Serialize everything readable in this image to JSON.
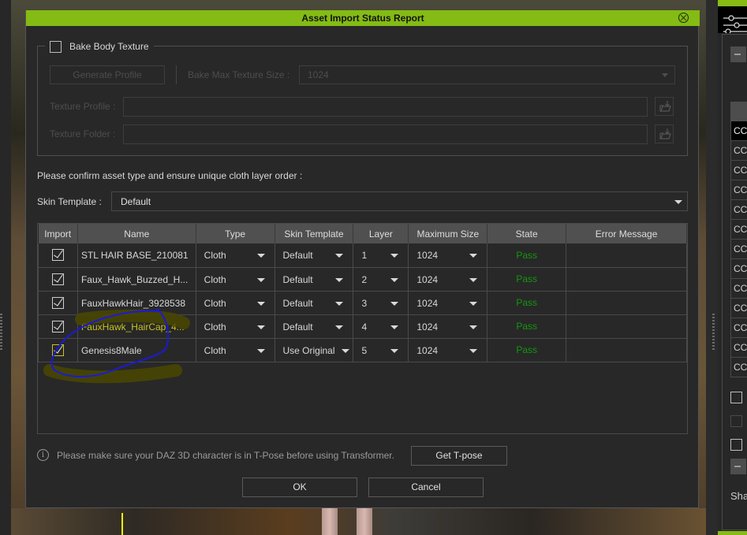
{
  "dialog": {
    "title": "Asset Import Status Report",
    "close_icon": "close-circle-icon",
    "bake_body_texture": {
      "label": "Bake Body Texture",
      "checked": false
    },
    "generate_profile_label": "Generate Profile",
    "bake_max_texture_size_label": "Bake Max Texture Size :",
    "bake_max_texture_size_value": "1024",
    "texture_profile_label": "Texture Profile :",
    "texture_profile_value": "",
    "texture_folder_label": "Texture Folder :",
    "texture_folder_value": "",
    "browse_icon": "folder-import-icon",
    "instruction": "Please confirm asset type and ensure unique cloth layer order :",
    "skin_template_label": "Skin Template :",
    "skin_template_value": "Default",
    "table": {
      "columns": [
        "Import",
        "Name",
        "Type",
        "Skin Template",
        "Layer",
        "Maximum Size",
        "State",
        "Error Message"
      ],
      "rows": [
        {
          "import": true,
          "name": "STL HAIR BASE_210081",
          "type": "Cloth",
          "skin_template": "Default",
          "layer": "1",
          "max_size": "1024",
          "state": "Pass",
          "error": ""
        },
        {
          "import": true,
          "name": "Faux_Hawk_Buzzed_H...",
          "type": "Cloth",
          "skin_template": "Default",
          "layer": "2",
          "max_size": "1024",
          "state": "Pass",
          "error": ""
        },
        {
          "import": true,
          "name": "FauxHawkHair_3928538",
          "type": "Cloth",
          "skin_template": "Default",
          "layer": "3",
          "max_size": "1024",
          "state": "Pass",
          "error": ""
        },
        {
          "import": true,
          "name": "FauxHawk_HairCap_4...",
          "type": "Cloth",
          "skin_template": "Default",
          "layer": "4",
          "max_size": "1024",
          "state": "Pass",
          "error": ""
        },
        {
          "import": true,
          "name": "Genesis8Male",
          "type": "Cloth",
          "skin_template": "Use Original",
          "layer": "5",
          "max_size": "1024",
          "state": "Pass",
          "error": ""
        }
      ]
    },
    "info_text": "Please make sure your DAZ 3D character is in T-Pose before using Transformer.",
    "get_tpose_label": "Get T-pose",
    "ok_label": "OK",
    "cancel_label": "Cancel"
  },
  "right_panel": {
    "settings_icon": "sliders-icon",
    "list_items": [
      "CC",
      "CC",
      "CC",
      "CC",
      "CC",
      "CC",
      "CC",
      "CC",
      "CC",
      "CC",
      "CC",
      "CC",
      "CC"
    ],
    "selected_index": 0,
    "bottom_label": "Sha"
  },
  "colors": {
    "accent_green": "#84bb14",
    "pass_green": "#139610",
    "annotation_blue": "#1a1ad8",
    "annotation_highlight": "#4a4600"
  }
}
